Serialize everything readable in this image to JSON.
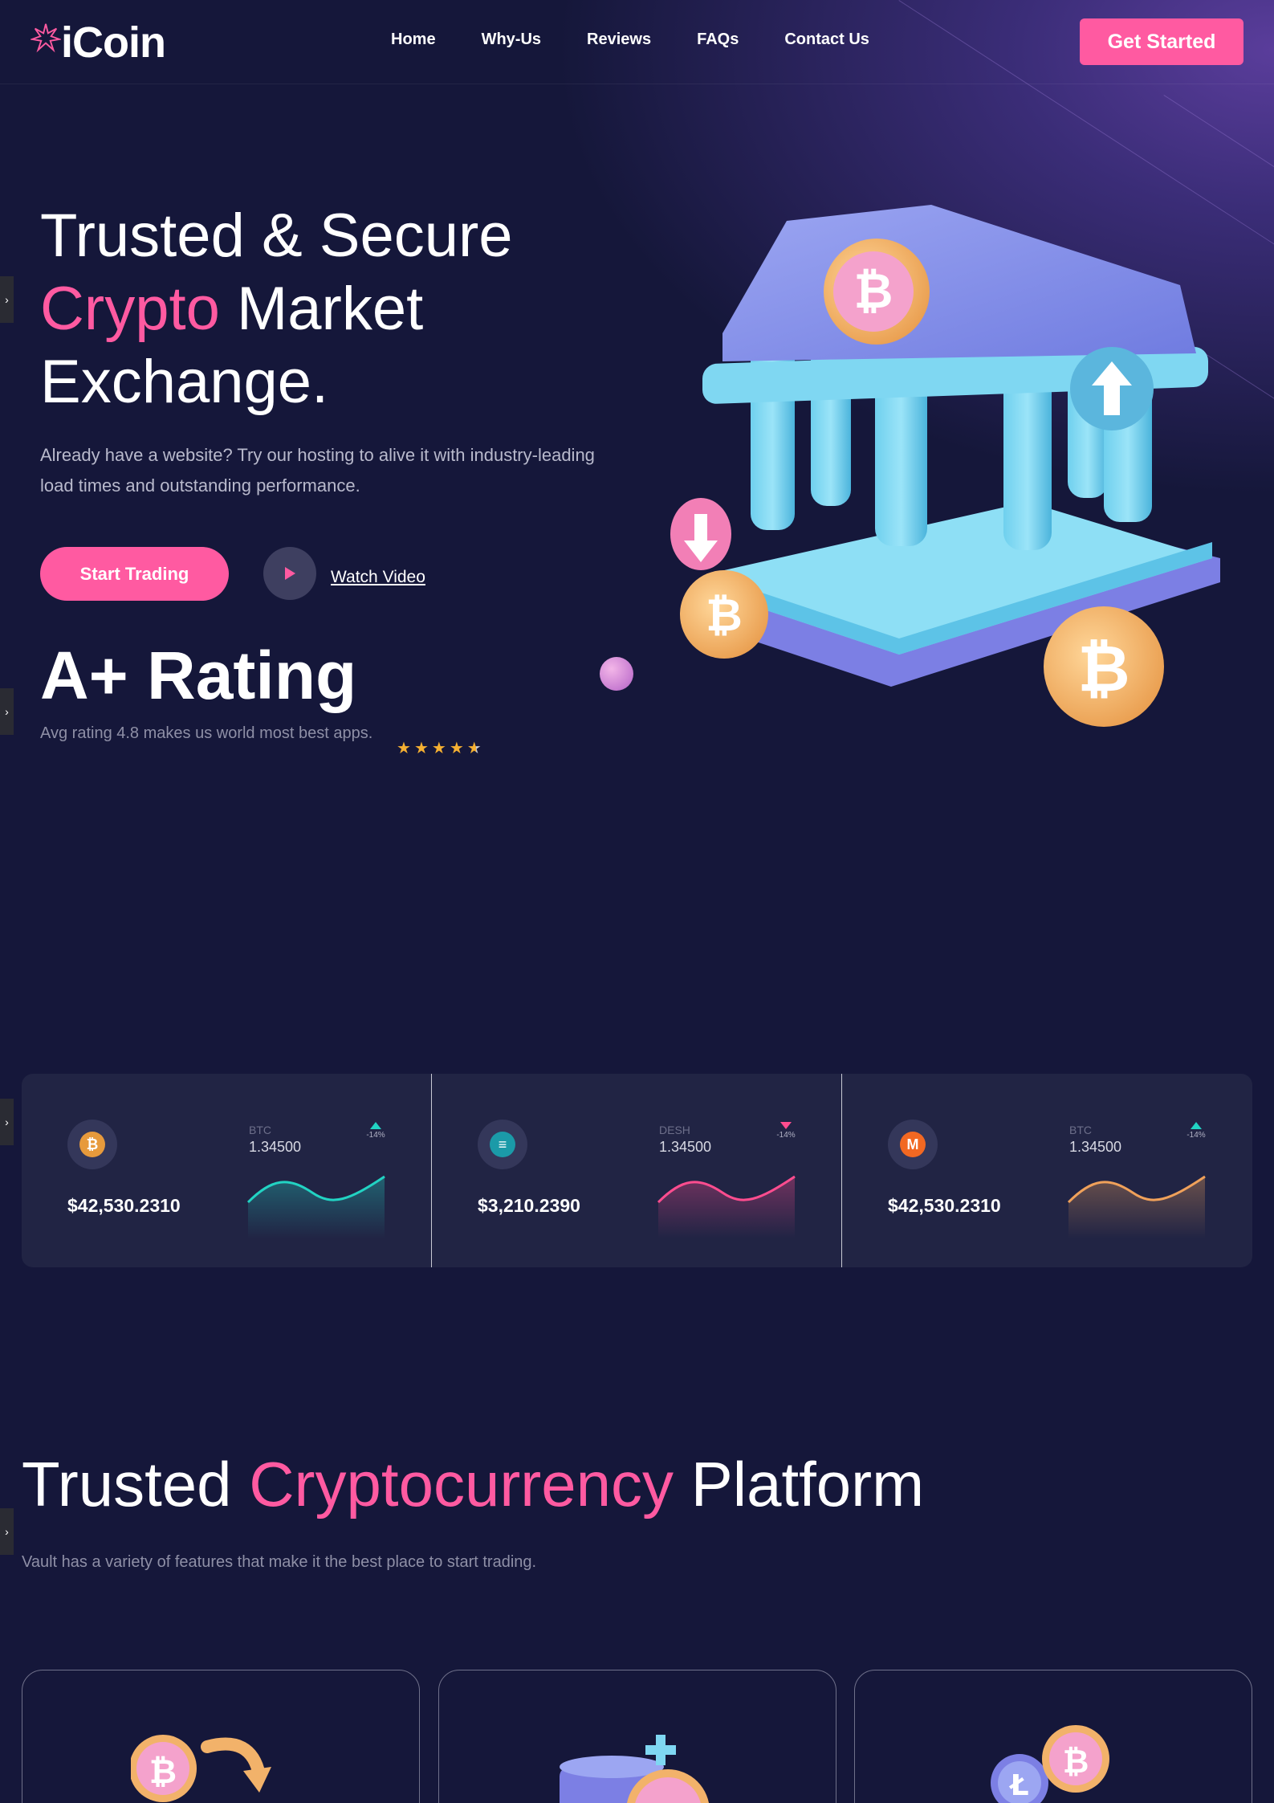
{
  "nav": {
    "logo": "iCoin",
    "menu": [
      "Home",
      "Why-Us",
      "Reviews",
      "FAQs",
      "Contact Us"
    ],
    "cta": "Get Started"
  },
  "hero": {
    "title_line1": "Trusted & Secure",
    "title_highlight": "Crypto",
    "title_line2_rest": " Market",
    "title_line3": "Exchange.",
    "description": "Already have a website? Try our hosting to alive it with industry-leading load times and outstanding performance.",
    "primary_button": "Start Trading",
    "video_link": "Watch Video",
    "rating_title": "A+ Rating",
    "rating_desc": "Avg rating 4.8 makes us world most best apps.",
    "rating_value": 4.8
  },
  "ticker": [
    {
      "symbol": "BTC",
      "value": "1.34500",
      "change": "-14%",
      "direction": "up",
      "price": "$42,530.2310",
      "icon": "bitcoin-icon",
      "color": "#22d3c3",
      "coin_color": "#e79a3c"
    },
    {
      "symbol": "DESH",
      "value": "1.34500",
      "change": "-14%",
      "direction": "down",
      "price": "$3,210.2390",
      "icon": "dash-icon",
      "color": "#ff4d8f",
      "coin_color": "#1b9aa8"
    },
    {
      "symbol": "BTC",
      "value": "1.34500",
      "change": "-14%",
      "direction": "up",
      "price": "$42,530.2310",
      "icon": "monero-icon",
      "color": "#f0a15a",
      "coin_color": "#f26822"
    }
  ],
  "section": {
    "title_start": "Trusted ",
    "title_highlight": "Cryptocurrency",
    "title_end": " Platform",
    "description": "Vault has a variety of features that make it the best place to start trading."
  },
  "colors": {
    "accent": "#ff5aa1",
    "background": "#15173a",
    "card": "#212444"
  }
}
